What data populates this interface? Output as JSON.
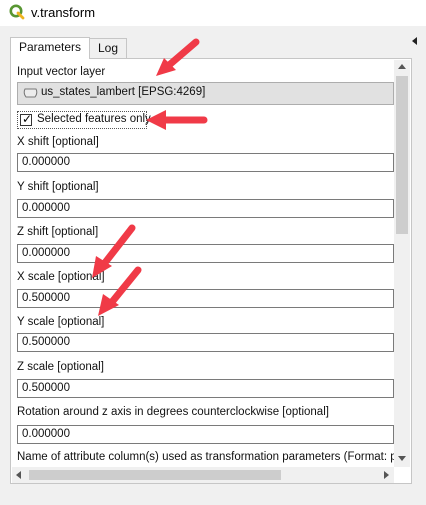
{
  "window": {
    "title": "v.transform",
    "app_icon": "qgis-logo-icon"
  },
  "tabs": [
    {
      "label": "Parameters",
      "active": true
    },
    {
      "label": "Log",
      "active": false
    }
  ],
  "form": {
    "input_layer": {
      "label": "Input vector layer",
      "value": "us_states_lambert [EPSG:4269]",
      "icon": "polygon-layer-icon"
    },
    "selected_only": {
      "label": "Selected features only",
      "checked": true
    },
    "x_shift": {
      "label": "X shift [optional]",
      "value": "0.000000"
    },
    "y_shift": {
      "label": "Y shift [optional]",
      "value": "0.000000"
    },
    "z_shift": {
      "label": "Z shift [optional]",
      "value": "0.000000"
    },
    "x_scale": {
      "label": "X scale [optional]",
      "value": "0.500000"
    },
    "y_scale": {
      "label": "Y scale [optional]",
      "value": "0.500000"
    },
    "z_scale": {
      "label": "Z scale [optional]",
      "value": "0.500000"
    },
    "rotation": {
      "label": "Rotation around z axis in degrees counterclockwise [optional]",
      "value": "0.000000"
    },
    "columns": {
      "label": "Name of attribute column(s) used as transformation parameters (Format: para"
    }
  },
  "annotations": {
    "arrow_color": "#f03a47"
  }
}
